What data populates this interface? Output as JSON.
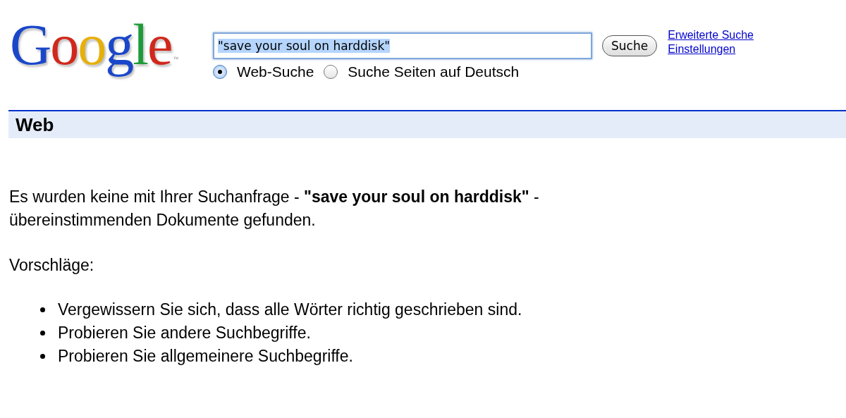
{
  "logo": {
    "letters": [
      {
        "char": "G",
        "color": "#1a47c9"
      },
      {
        "char": "o",
        "color": "#d1281c"
      },
      {
        "char": "o",
        "color": "#e6b00c"
      },
      {
        "char": "g",
        "color": "#1a47c9"
      },
      {
        "char": "l",
        "color": "#1e9a3a"
      },
      {
        "char": "e",
        "color": "#d1281c"
      }
    ],
    "mark": "™"
  },
  "search": {
    "value": "\"save your soul on harddisk\"",
    "button": "Suche"
  },
  "scope": [
    {
      "label": "Web-Suche",
      "selected": true
    },
    {
      "label": "Suche Seiten auf Deutsch",
      "selected": false
    }
  ],
  "links": [
    "Erweiterte Suche",
    "Einstellungen"
  ],
  "section_title": "Web",
  "message": "Es wurden keine mit Ihrer Suchanfrage - **\"save your soul on harddisk\"** - übereinstimmenden Dokumente gefunden.",
  "suggestions_title": "Vorschläge:",
  "suggestions": [
    "Vergewissern Sie sich, dass alle Wörter richtig geschrieben sind.",
    "Probieren Sie andere Suchbegriffe.",
    "Probieren Sie allgemeinere Suchbegriffe."
  ]
}
